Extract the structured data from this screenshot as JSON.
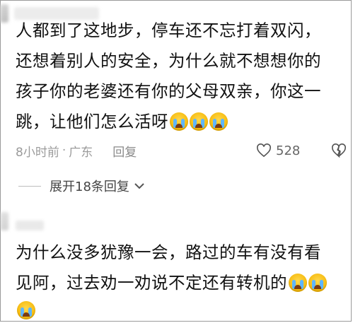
{
  "comment1": {
    "line1": "人都到了这地步，停车还不忘打着双闪，",
    "line2": "还想着别人的安全，为什么就不想想你的",
    "line3": "孩子你的老婆还有你的父母双亲，你这一",
    "line4": "跳，让他们怎么活呀",
    "emojis": [
      "crying-face",
      "crying-face",
      "crying-face"
    ],
    "time": "8小时前",
    "separator": "·",
    "location": "广东",
    "reply_label": "回复",
    "like_count": "528"
  },
  "expand_replies": {
    "label": "展开18条回复"
  },
  "comment2": {
    "line1": "为什么没多犹豫一会，路过的车有没有看",
    "line2": "见阿，过去劝一劝说不定还有转机的",
    "emojis": [
      "crying-face",
      "crying-face",
      "crying-face"
    ]
  },
  "colors": {
    "meta_text": "#9b9b9b",
    "emoji": "#f4b400",
    "tear": "#5fb6ff"
  }
}
